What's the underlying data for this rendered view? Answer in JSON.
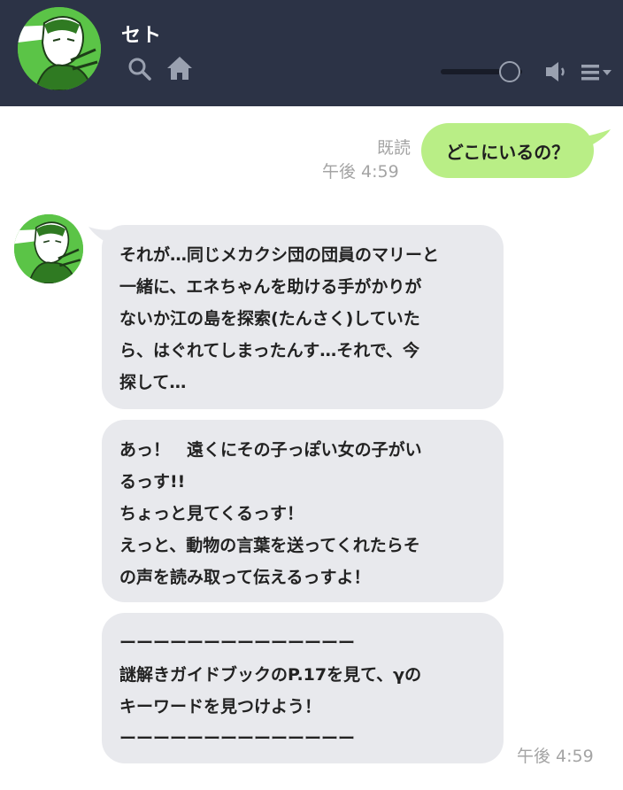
{
  "header": {
    "contact_name": "セト",
    "avatar_icon": "character-avatar-icon",
    "search_icon": "search-icon",
    "home_icon": "home-icon",
    "volume_level": 0.85,
    "speaker_icon": "speaker-icon",
    "menu_icon": "menu-dropdown-icon",
    "background": "#2c3346"
  },
  "outgoing": {
    "read_label": "既読",
    "time": "午後 4:59",
    "text": "どこにいるの？",
    "bubble_color": "#b9ee86"
  },
  "incoming": {
    "bubble_color": "#e8e9ed",
    "messages": [
      {
        "text": "それが…同じメカクシ団の団員のマリーと\n一緒に、エネちゃんを助ける手がかりが\nないか江の島を探索(たんさく)していた\nら、はぐれてしまったんす…それで、今\n探して…"
      },
      {
        "text": "あっ！　遠くにその子っぽい女の子がい\nるっす!!\nちょっと見てくるっす！\nえっと、動物の言葉を送ってくれたらそ\nの声を読み取って伝えるっすよ！"
      },
      {
        "text": "ーーーーーーーーーーーーーー\n謎解きガイドブックのP.17を見て、γの\nキーワードを見つけよう！\nーーーーーーーーーーーーーー"
      }
    ],
    "time": "午後 4:59"
  }
}
